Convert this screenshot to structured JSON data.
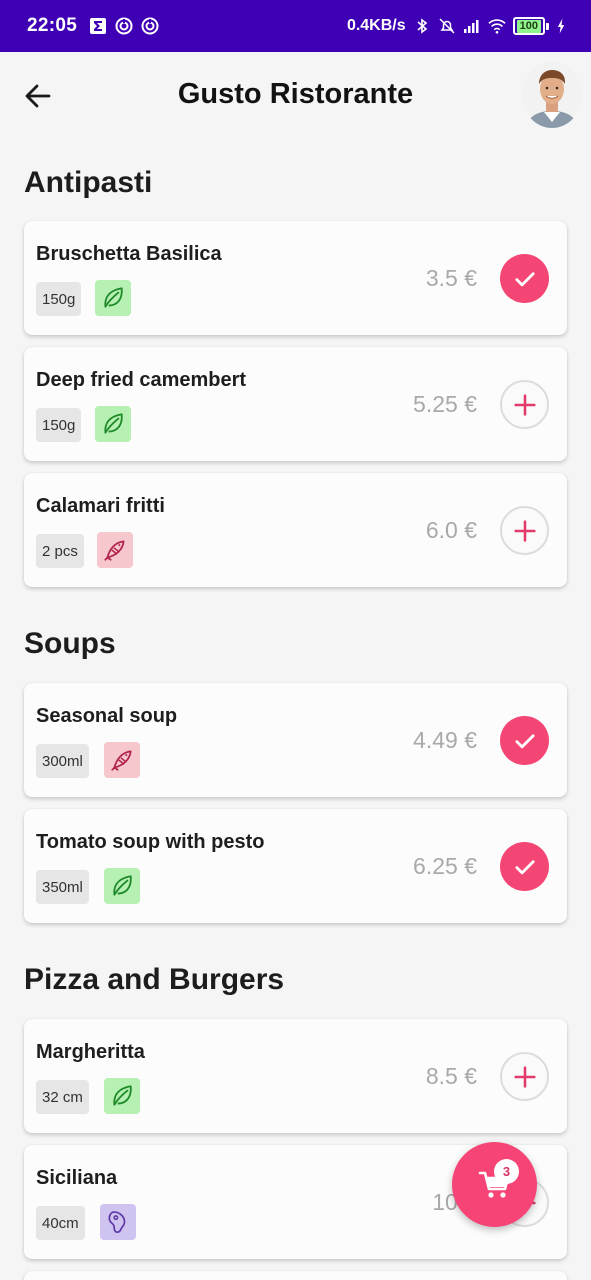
{
  "status_bar": {
    "time": "22:05",
    "network_speed": "0.4KB/s",
    "battery": "100",
    "icons": [
      "sigma-notification-icon",
      "sync-icon",
      "sync-icon",
      "bluetooth-icon",
      "alarm-off-icon",
      "signal-icon",
      "wifi-icon",
      "battery-icon",
      "charging-icon"
    ]
  },
  "app_bar": {
    "title": "Gusto Ristorante",
    "back_icon": "arrow-back-icon",
    "avatar": "user-avatar"
  },
  "colors": {
    "status_bar": "#3f00b5",
    "accent": "#f44675",
    "vegetarian_bg": "#b6f0b3",
    "fish_bg": "#f6c7cc",
    "meat_bg": "#cfc3f0",
    "price": "#a9a9a9"
  },
  "sections": [
    {
      "title": "Antipasti",
      "items": [
        {
          "name": "Bruschetta Basilica",
          "quantity": "150g",
          "diet": "leaf-icon",
          "price": "3.5 €",
          "state": "selected"
        },
        {
          "name": "Deep fried camembert",
          "quantity": "150g",
          "diet": "leaf-icon",
          "price": "5.25 €",
          "state": "add"
        },
        {
          "name": "Calamari fritti",
          "quantity": "2 pcs",
          "diet": "fish-icon",
          "price": "6.0 €",
          "state": "add"
        }
      ]
    },
    {
      "title": "Soups",
      "items": [
        {
          "name": "Seasonal soup",
          "quantity": "300ml",
          "diet": "fish-icon",
          "price": "4.49 €",
          "state": "selected"
        },
        {
          "name": "Tomato soup with pesto",
          "quantity": "350ml",
          "diet": "leaf-icon",
          "price": "6.25 €",
          "state": "selected"
        }
      ]
    },
    {
      "title": "Pizza and Burgers",
      "items": [
        {
          "name": "Margheritta",
          "quantity": "32 cm",
          "diet": "leaf-icon",
          "price": "8.5 €",
          "state": "add"
        },
        {
          "name": "Siciliana",
          "quantity": "40cm",
          "diet": "meat-icon",
          "price": "10.3",
          "state": "add"
        }
      ]
    }
  ],
  "cart": {
    "icon": "cart-icon",
    "count": "3"
  }
}
